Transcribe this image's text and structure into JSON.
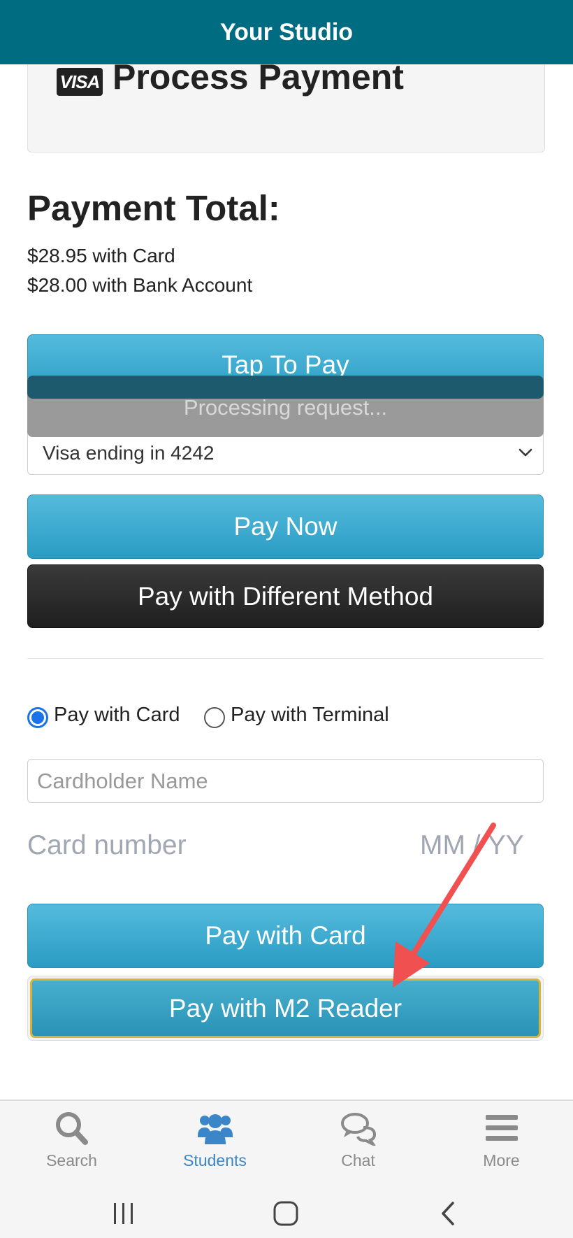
{
  "app": {
    "title": "Your Studio"
  },
  "header_card": {
    "card_brand": "VISA",
    "title": "Process Payment"
  },
  "payment_total": {
    "heading": "Payment Total:",
    "card_line": "$28.95 with Card",
    "bank_line": "$28.00 with Bank Account"
  },
  "actions": {
    "tap_to_pay": "Tap To Pay",
    "processing": "Processing request...",
    "saved_method": "Visa ending in 4242",
    "pay_now": "Pay Now",
    "pay_different": "Pay with Different Method"
  },
  "payment_mode": {
    "options": [
      {
        "label": "Pay with Card",
        "selected": true
      },
      {
        "label": "Pay with Terminal",
        "selected": false
      }
    ]
  },
  "card_form": {
    "cardholder_placeholder": "Cardholder Name",
    "card_number_placeholder": "Card number",
    "expiry_placeholder": "MM / YY",
    "pay_card": "Pay with Card",
    "pay_m2": "Pay with M2 Reader"
  },
  "bottom_nav": {
    "items": [
      {
        "label": "Search",
        "icon": "search-icon",
        "active": false
      },
      {
        "label": "Students",
        "icon": "users-icon",
        "active": true
      },
      {
        "label": "Chat",
        "icon": "chat-icon",
        "active": false
      },
      {
        "label": "More",
        "icon": "menu-icon",
        "active": false
      }
    ]
  },
  "colors": {
    "top_bar": "#006c82",
    "primary_button": "#3aa8cf",
    "dark_button": "#2a2a2a",
    "highlight_border": "#d8b33a",
    "annotation_arrow": "#f05050",
    "active_nav": "#3a86c8"
  }
}
